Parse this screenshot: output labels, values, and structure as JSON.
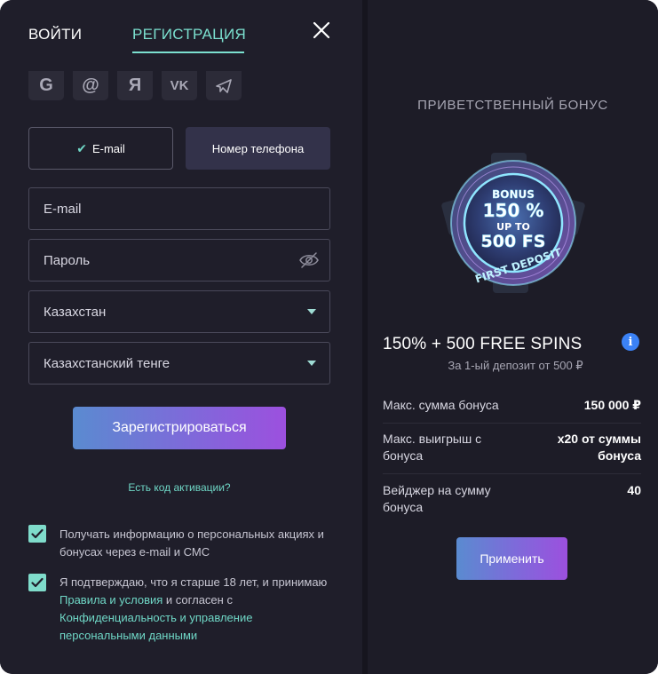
{
  "tabs": {
    "login": "ВОЙТИ",
    "register": "РЕГИСТРАЦИЯ"
  },
  "social": {
    "google": "G",
    "mail": "@",
    "yandex": "Я",
    "vk": "VK",
    "telegram": ""
  },
  "contact_toggle": {
    "email": "E-mail",
    "phone": "Номер телефона"
  },
  "form": {
    "email_placeholder": "E-mail",
    "password_placeholder": "Пароль",
    "country": "Казахстан",
    "currency": "Казахстанский тенге"
  },
  "register_button": "Зарегистрироваться",
  "activation_link": "Есть код активации?",
  "consents": {
    "promo": "Получать информацию о персональных акциях и бонусах через e-mail и СМС",
    "age_prefix": "Я подтверждаю, что я старше 18 лет, и принимаю ",
    "age_rules_link": "Правила и условия",
    "age_middle": " и согласен с ",
    "age_privacy_link": "Конфиденциальность и управление персональными данными"
  },
  "bonus": {
    "header": "ПРИВЕТСТВЕННЫЙ БОНУС",
    "chip": {
      "line1": "BONUS",
      "line2": "150 %",
      "line3": "UP TO",
      "line4": "500 FS",
      "ring": "FIRST DEPOSIT"
    },
    "title": "150% + 500 FREE SPINS",
    "info": "i",
    "subtitle": "За 1-ый депозит от 500 ₽",
    "rows": [
      {
        "label": "Макс. сумма бонуса",
        "value": "150 000 ₽"
      },
      {
        "label": "Макс. выигрыш с бонуса",
        "value": "x20 от суммы бонуса"
      },
      {
        "label": "Вейджер на сумму бонуса",
        "value": "40"
      }
    ],
    "apply_button": "Применить"
  },
  "colors": {
    "accent": "#7be0cf",
    "panel_left": "#1f1e2a",
    "panel_right": "#1d1c27",
    "info": "#3b82f6",
    "button_gradient_start": "#5a8bd0",
    "button_gradient_end": "#9c50de"
  }
}
